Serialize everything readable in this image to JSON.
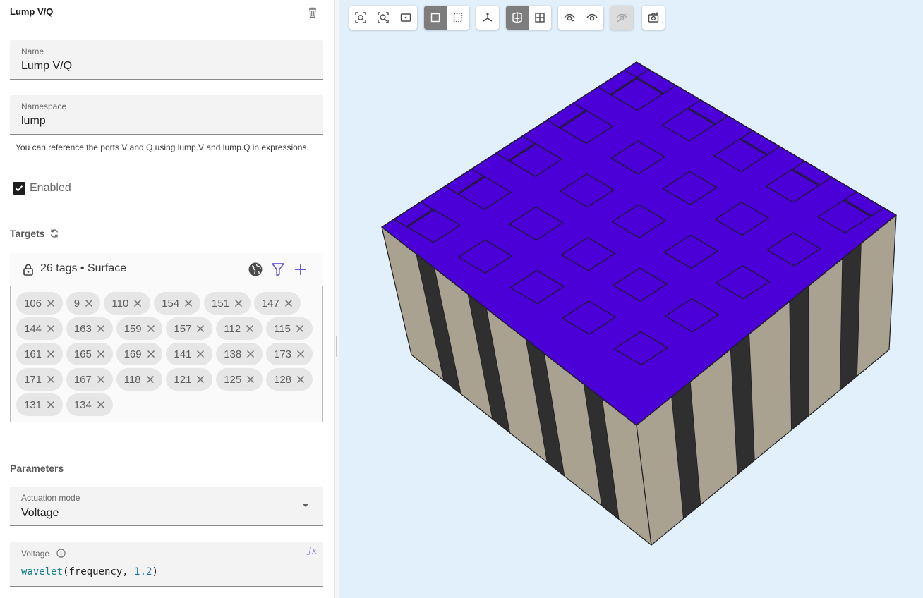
{
  "panel": {
    "title": "Lump V/Q",
    "name_field": {
      "label": "Name",
      "value": "Lump V/Q"
    },
    "namespace_field": {
      "label": "Namespace",
      "value": "lump"
    },
    "help_text": "You can reference the ports V and Q using lump.V and lump.Q in expressions.",
    "enabled": {
      "label": "Enabled",
      "checked": true
    },
    "targets": {
      "title": "Targets",
      "summary": "26 tags • Surface",
      "rows": [
        [
          "106",
          "9",
          "110",
          "154",
          "151",
          "147"
        ],
        [
          "144",
          "163",
          "159",
          "157",
          "112",
          "115"
        ],
        [
          "161",
          "165",
          "169",
          "141",
          "138",
          "173"
        ],
        [
          "171",
          "167",
          "118",
          "121",
          "125",
          "128"
        ],
        [
          "131",
          "134"
        ]
      ]
    },
    "parameters": {
      "title": "Parameters",
      "actuation_mode": {
        "label": "Actuation mode",
        "value": "Voltage"
      },
      "voltage": {
        "label": "Voltage",
        "fn": "wavelet",
        "args": "(frequency, ",
        "num": "1.2",
        "close": ")"
      }
    }
  },
  "viewport": {
    "background": "#e2f0fb",
    "top_face_color": "#4a00d6",
    "side_light_color": "#a9a291",
    "side_dark_color": "#2f2f30",
    "toolbar": [
      [
        "fit-selection-icon",
        "zoom-fit-icon",
        "frame-icon"
      ],
      [
        "solid-view-icon",
        "wireframe-view-icon"
      ],
      [
        "axes-icon"
      ],
      [
        "mesh-view-icon",
        "grid-view-icon"
      ],
      [
        "hide-icon",
        "show-icon"
      ],
      [
        "visibility-disabled-icon"
      ],
      [
        "screenshot-icon"
      ]
    ]
  }
}
